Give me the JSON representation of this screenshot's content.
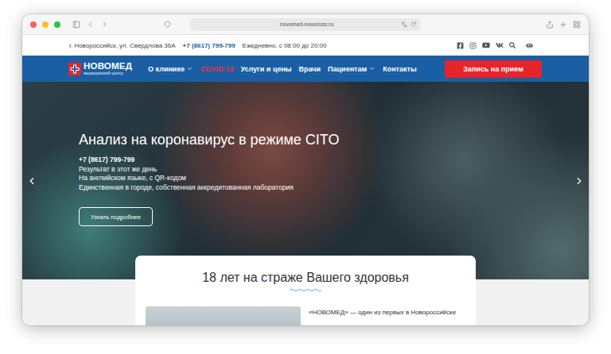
{
  "browser": {
    "url": "novomed-novoross.ru"
  },
  "topbar": {
    "address": "г. Новороссийск, ул. Свердлова 36А",
    "phone": "+7 (8617) 799-799",
    "hours": "Ежедневно, с 08:00 до 20:00"
  },
  "nav": {
    "logo_title": "НОВОМЕД",
    "logo_subtitle": "медицинский центр",
    "items": [
      {
        "label": "О клинике",
        "dropdown": true,
        "highlighted": false
      },
      {
        "label": "COVID-19",
        "dropdown": false,
        "highlighted": true
      },
      {
        "label": "Услуги и цены",
        "dropdown": false,
        "highlighted": false
      },
      {
        "label": "Врачи",
        "dropdown": false,
        "highlighted": false
      },
      {
        "label": "Пациентам",
        "dropdown": true,
        "highlighted": false
      },
      {
        "label": "Контакты",
        "dropdown": false,
        "highlighted": false
      }
    ],
    "cta": "Запись на прием"
  },
  "hero": {
    "title": "Анализ на коронавирус в режиме CITO",
    "phone": "+7 (8617) 799-799",
    "lines": [
      "Результат в этот же день",
      "На английском языке, с QR-кодом",
      "Единственная в городе, собственная аккредитованная лаборатория"
    ],
    "button": "Узнать подробнее"
  },
  "about": {
    "title": "18 лет на страже Вашего здоровья",
    "text": "«НОВОМЕД» — один из первых в Новороссийске"
  }
}
